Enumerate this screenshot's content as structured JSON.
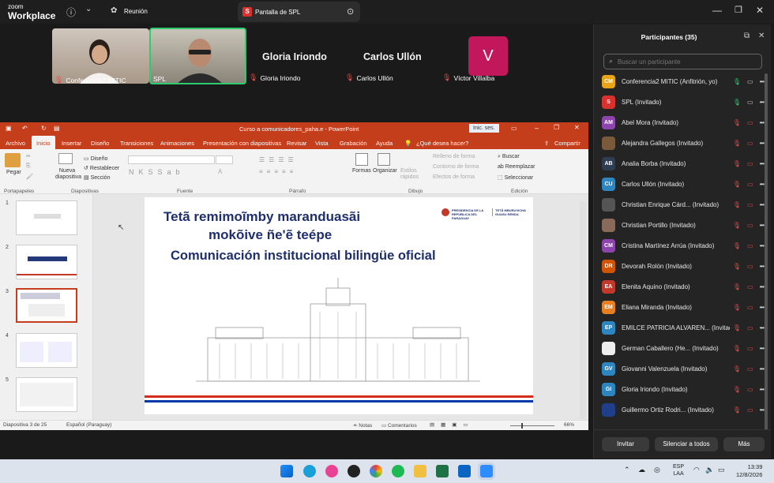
{
  "zoom": {
    "logo_top": "zoom",
    "logo_bottom": "Workplace",
    "meeting_label": "Reunión",
    "tab_badge": "S",
    "tab_label": "Pantalla de SPL"
  },
  "videos": [
    {
      "name": "Conferencia2 MITIC"
    },
    {
      "name": "SPL"
    },
    {
      "name": "Gloria Iriondo"
    },
    {
      "name": "Carlos Ullón"
    },
    {
      "name": "Víctor Villalba",
      "initial": "V"
    }
  ],
  "ppt": {
    "title": "Curso a comunicadores_paha.e  -  PowerPoint",
    "signin": "Inic. ses.",
    "menu": [
      "Archivo",
      "Inicio",
      "Insertar",
      "Diseño",
      "Transiciones",
      "Animaciones",
      "Presentación con diapositivas",
      "Revisar",
      "Vista",
      "Grabación",
      "Ayuda"
    ],
    "tell_me": "¿Qué desea hacer?",
    "share": "Compartir",
    "ribbon": {
      "paste": "Pegar",
      "new_slide": "Nueva diapositiva",
      "design": "Diseño",
      "reset": "Restablecer",
      "section": "Sección",
      "shapes": "Formas",
      "arrange": "Organizar",
      "quick_styles": "Estilos rápidos",
      "fill": "Relleno de forma",
      "outline": "Contorno de forma",
      "effects": "Efectos de forma",
      "find": "Buscar",
      "replace": "Reemplazar",
      "select": "Seleccionar",
      "groups": [
        "Portapapeles",
        "Diapositivas",
        "Fuente",
        "Párrafo",
        "Dibujo",
        "Edición"
      ]
    },
    "slide": {
      "title_line1": "Tetã remimoĩmby maranduasãi",
      "title_line2": "mokõive ñe'ẽ teépe",
      "subtitle": "Comunicación institucional bilingüe oficial",
      "logo_left": "PRESIDENCIA DE LA REPÚBLICA DEL PARAGUAY",
      "logo_right": "TETÃ MBURUVICHA GUASU RÉNDA"
    },
    "thumb_numbers": [
      "1",
      "2",
      "3",
      "4",
      "5"
    ],
    "status": {
      "slide": "Diapositiva 3 de 25",
      "lang": "Español (Paraguay)",
      "notes": "Notas",
      "comments": "Comentarios",
      "zoom": "66%"
    }
  },
  "participants": {
    "title": "Participantes (35)",
    "search_placeholder": "Buscar un participante",
    "list": [
      {
        "initials": "CM",
        "color": "#e8a317",
        "name": "Conferencia2 MITIC (Anfitrión, yo)"
      },
      {
        "initials": "S",
        "color": "#d9322e",
        "name": "SPL (Invitado)"
      },
      {
        "initials": "AM",
        "color": "#8e44ad",
        "name": "Abel Mora (Invitado)"
      },
      {
        "initials": "",
        "color": "#7a5a3a",
        "name": "Alejandra Gallegos (Invitado)"
      },
      {
        "initials": "AB",
        "color": "#2c3e50",
        "name": "Analia Borba (Invitado)"
      },
      {
        "initials": "CU",
        "color": "#2e86c1",
        "name": "Carlos Ullón (Invitado)"
      },
      {
        "initials": "",
        "color": "#555555",
        "name": "Christian Enrique Cárd... (Invitado)"
      },
      {
        "initials": "",
        "color": "#8a6a5a",
        "name": "Christian Portillo (Invitado)"
      },
      {
        "initials": "CM",
        "color": "#8e44ad",
        "name": "Cristina Martínez Arrúa (Invitado)"
      },
      {
        "initials": "DR",
        "color": "#d35400",
        "name": "Devorah Rolón (Invitado)"
      },
      {
        "initials": "EA",
        "color": "#c0392b",
        "name": "Elenita Aquino (Invitado)"
      },
      {
        "initials": "EM",
        "color": "#e67e22",
        "name": "Eliana Miranda (Invitado)"
      },
      {
        "initials": "EP",
        "color": "#2e86c1",
        "name": "EMILCE PATRICIA ALVAREN... (Invitado)"
      },
      {
        "initials": "",
        "color": "#eeeeee",
        "name": "German Caballero (He... (Invitado)"
      },
      {
        "initials": "GV",
        "color": "#2e86c1",
        "name": "Giovanni Valenzuela (Invitado)"
      },
      {
        "initials": "GI",
        "color": "#2e86c1",
        "name": "Gloria Iriondo (Invitado)"
      },
      {
        "initials": "",
        "color": "#1f3f8a",
        "name": "Guillermo Ortiz Rodri... (Invitado)"
      }
    ],
    "invite": "Invitar",
    "mute_all": "Silenciar a todos",
    "more": "Más"
  },
  "taskbar": {
    "lang_top": "ESP",
    "lang_bottom": "LAA",
    "time": "13:39",
    "date": "12/8/2026"
  }
}
